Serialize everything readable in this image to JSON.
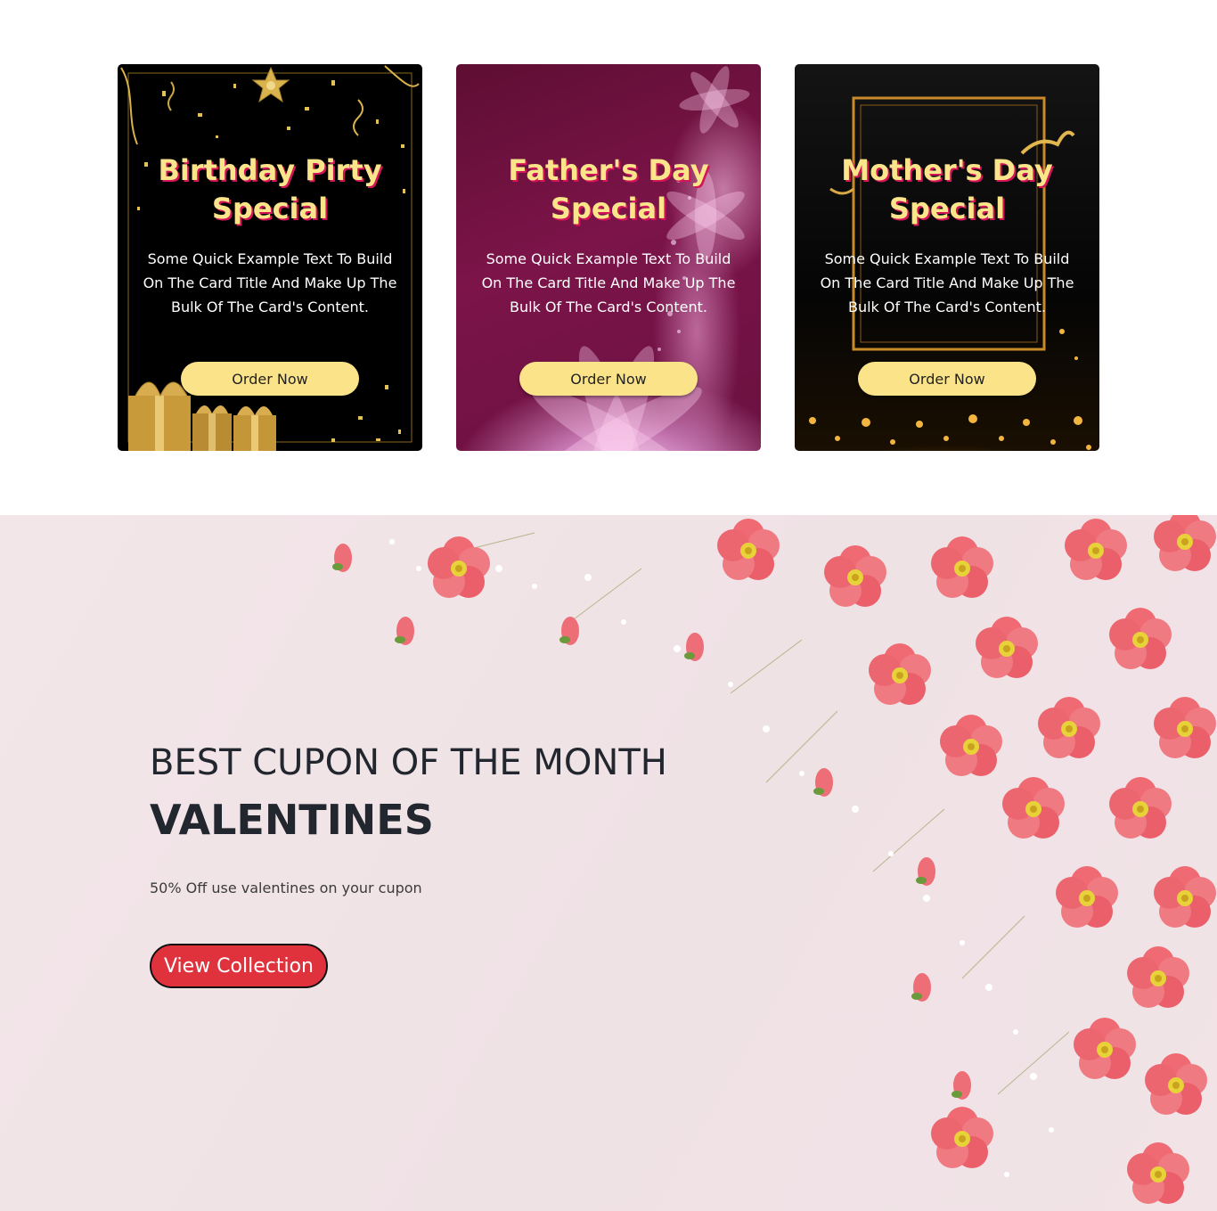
{
  "cards": [
    {
      "title": "Birthday Pirty Special",
      "text": "Some Quick Example Text To Build On The Card Title And Make Up The Bulk Of The Card's Content.",
      "button_label": "Order Now"
    },
    {
      "title": "Father's Day Special",
      "text": "Some Quick Example Text To Build On The Card Title And Make Up The Bulk Of The Card's Content.",
      "button_label": "Order Now"
    },
    {
      "title": "Mother's Day Special",
      "text": "Some Quick Example Text To Build On The Card Title And Make Up The Bulk Of The Card's Content.",
      "button_label": "Order Now"
    }
  ],
  "hero": {
    "eyebrow": "BEST CUPON OF THE MONTH",
    "title": "VALENTINES",
    "description": "50% Off use valentines on your cupon",
    "button_label": "View Collection"
  },
  "colors": {
    "card_title": "#fbe58a",
    "card_title_shadow": "#d4145a",
    "order_button": "#fbe38a",
    "hero_button": "#e0323d",
    "hero_background": "#f1e4e7",
    "flower": "#ef6a72"
  }
}
